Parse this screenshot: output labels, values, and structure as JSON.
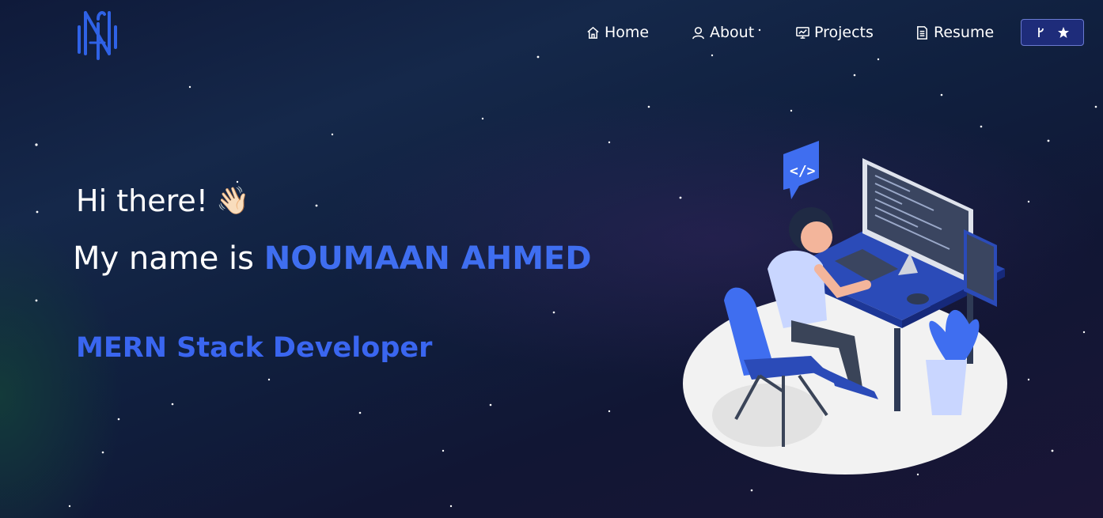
{
  "nav": {
    "logo_icon": "logo-monogram-icon",
    "items": [
      {
        "label": "Home",
        "icon": "home-icon"
      },
      {
        "label": "About",
        "icon": "user-icon"
      },
      {
        "label": "Projects",
        "icon": "presentation-icon"
      },
      {
        "label": "Resume",
        "icon": "document-icon"
      }
    ],
    "github_button": {
      "icons": [
        "fork-icon",
        "star-icon"
      ]
    }
  },
  "hero": {
    "greeting": "Hi there!",
    "wave_emoji": "👋🏻",
    "name_prefix": "My name is ",
    "name": "NOUMAAN AHMED",
    "role": "MERN Stack Developer"
  },
  "colors": {
    "background": "#0e1433",
    "accent": "#3f6ef0",
    "button_bg": "#1e2c7a"
  }
}
